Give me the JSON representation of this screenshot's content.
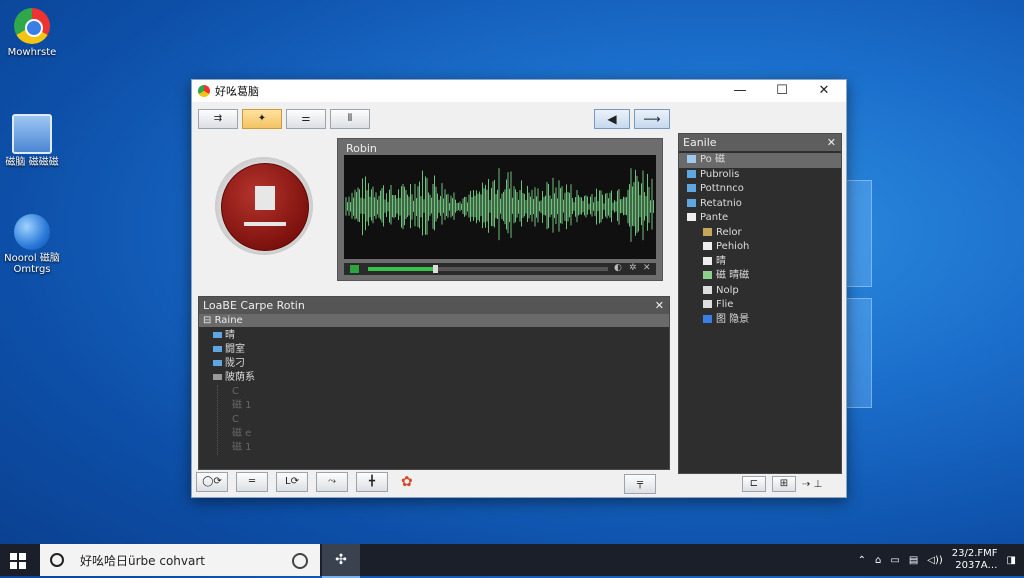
{
  "desktop": {
    "icons": [
      {
        "label": "Mowhrste"
      },
      {
        "label": "磁脑 磁磁磁"
      },
      {
        "label": "Noorol 磁脑 Omtrgs"
      }
    ]
  },
  "window": {
    "title": "好吆葛脑",
    "controls": {
      "minimize": "—",
      "maximize": "☐",
      "close": "✕"
    },
    "toolbar": [
      "⇉",
      "✦",
      "⚌",
      "⫴"
    ],
    "nav": {
      "back": "◀",
      "forward": "⟶"
    },
    "waveform": {
      "title": "Robin",
      "progress": 0.27,
      "wave_color": "#6fc07c"
    },
    "lower_panel": {
      "title": "LoaBE  Carpe Rotin",
      "close": "✕",
      "root": "Raine",
      "items": [
        "晴",
        "闘室",
        "陇刁",
        "陂荫系"
      ],
      "faint_items": [
        "C",
        "磁 1",
        "C",
        "磁 e",
        "磁 1"
      ]
    },
    "right_panel": {
      "title": "Eanile",
      "close": "✕",
      "items": [
        {
          "label": "Po 磁",
          "selected": true
        },
        {
          "label": "Pubrolis",
          "selected": false
        },
        {
          "label": "Pottnnco",
          "selected": false
        },
        {
          "label": "Retatnio",
          "selected": false
        },
        {
          "label": "Pante",
          "selected": false
        },
        {
          "label": "Relor",
          "selected": false
        },
        {
          "label": "Pehioh",
          "selected": false
        },
        {
          "label": "晴",
          "selected": false
        },
        {
          "label": "磁 晴磁",
          "selected": false
        },
        {
          "label": "Nolp",
          "selected": false
        },
        {
          "label": "Flie",
          "selected": false
        },
        {
          "label": "图 隐景",
          "selected": false
        }
      ]
    },
    "bottom_toolbar": {
      "buttons": [
        "◯⟳",
        "═",
        "L⟳",
        "⤳",
        "╋"
      ],
      "extra": "╤",
      "right": [
        "⊏",
        "⊞",
        "⇢ ⊥"
      ]
    }
  },
  "taskbar": {
    "search_text": "好吆哈⽇ürbe cohvart",
    "clock_time": "23/2.FMF",
    "clock_date": "2037A…"
  }
}
